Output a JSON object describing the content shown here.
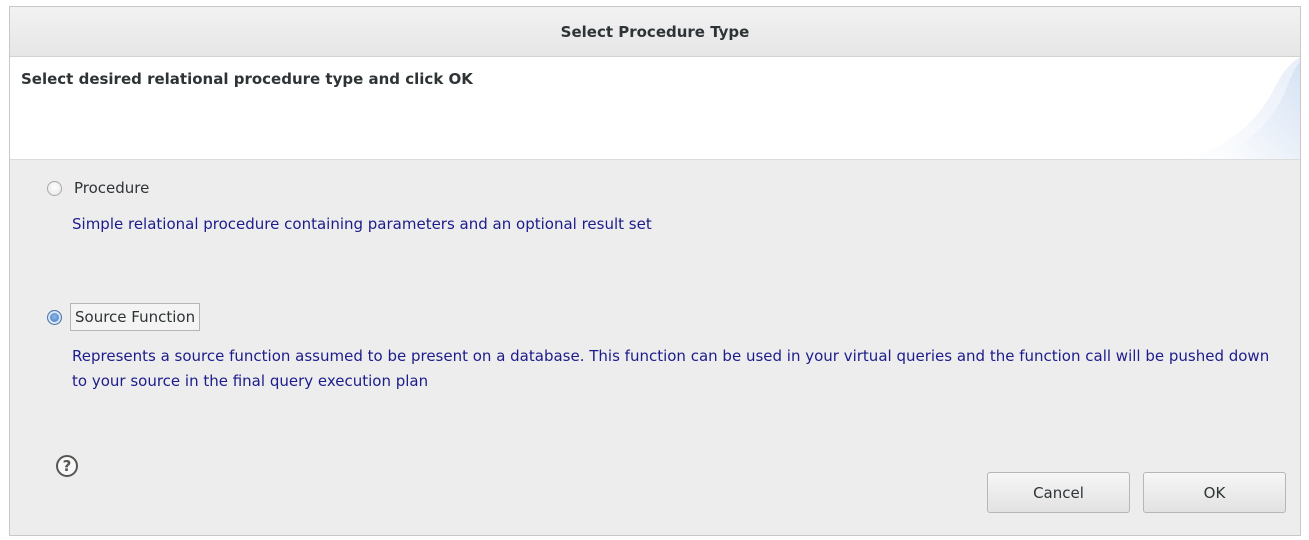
{
  "window": {
    "title": "Select Procedure Type"
  },
  "header": {
    "message": "Select desired relational procedure type and click OK"
  },
  "options": [
    {
      "label": "Procedure",
      "description": "Simple relational procedure containing parameters and an optional result set",
      "selected": false
    },
    {
      "label": "Source Function",
      "description": "Represents a source function assumed to be present on a database. This function can be used in your virtual queries and the function call will be pushed down to your source in the final query execution plan",
      "selected": true
    }
  ],
  "footer": {
    "help_glyph": "?",
    "help_icon": "help-icon",
    "cancel_label": "Cancel",
    "ok_label": "OK"
  },
  "colors": {
    "description_text": "#1c1c8c",
    "selected_radio": "#5b8fd0",
    "dialog_background": "#ededed"
  }
}
